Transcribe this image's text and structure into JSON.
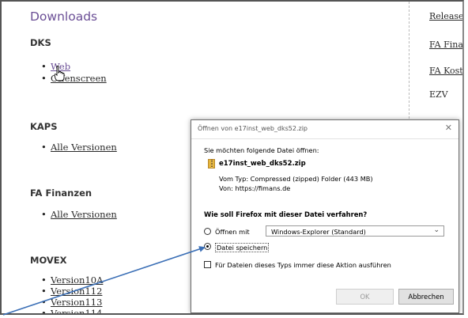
{
  "page": {
    "title": "Downloads",
    "sections": [
      {
        "heading": "DKS",
        "links": [
          "Web",
          "Offenscreen"
        ]
      },
      {
        "heading": "KAPS",
        "links": [
          "Alle Versionen"
        ]
      },
      {
        "heading": "FA Finanzen",
        "links": [
          "Alle Versionen"
        ]
      },
      {
        "heading": "MOVEX",
        "links": [
          "Version10A",
          "Version112",
          "Version113",
          "Version114"
        ]
      }
    ]
  },
  "right_nav": {
    "links": [
      "Release",
      "FA Finan",
      "FA Koste"
    ],
    "text": "EZV"
  },
  "dialog": {
    "title": "Öffnen von e17inst_web_dks52.zip",
    "question": "Sie möchten folgende Datei öffnen:",
    "file_name": "e17inst_web_dks52.zip",
    "file_type": "Vom Typ:  Compressed (zipped) Folder (443 MB)",
    "file_from": "Von:  https://fimans.de",
    "action_heading": "Wie soll Firefox mit dieser Datei verfahren?",
    "open_with_label": "Öffnen mit",
    "open_with_value": "Windows-Explorer (Standard)",
    "save_label": "Datei speichern",
    "remember_label": "Für Dateien dieses Typs immer diese Aktion ausführen",
    "ok_label": "OK",
    "cancel_label": "Abbrechen",
    "open_with_selected": false,
    "save_selected": true,
    "remember_checked": false
  },
  "colors": {
    "title": "#6b4f96",
    "annotation_arrow": "#3b6fb6"
  }
}
